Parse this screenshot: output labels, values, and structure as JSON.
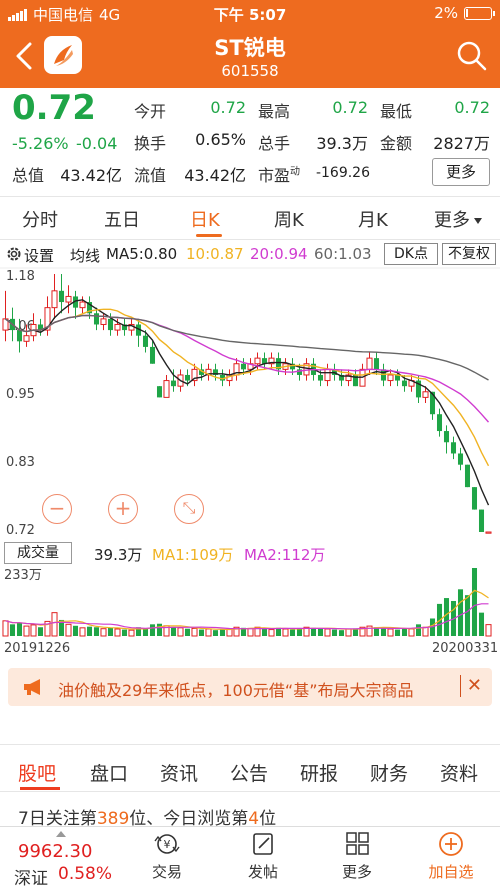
{
  "status": {
    "carrier": "中国电信",
    "network": "4G",
    "time": "下午 5:07",
    "battery": "2%"
  },
  "header": {
    "title": "ST锐电",
    "code": "601558"
  },
  "quote": {
    "price": "0.72",
    "change_pct": "-5.26%",
    "change": "-0.04",
    "fields": [
      {
        "label": "今开",
        "value": "0.72",
        "color": "#1fa547"
      },
      {
        "label": "最高",
        "value": "0.72",
        "color": "#1fa547"
      },
      {
        "label": "最低",
        "value": "0.72",
        "color": "#1fa547"
      },
      {
        "label": "换手",
        "value": "0.65%",
        "color": "#222222"
      },
      {
        "label": "总手",
        "value": "39.3万",
        "color": "#222222"
      },
      {
        "label": "金额",
        "value": "2827万",
        "color": "#222222"
      },
      {
        "label": "总值",
        "value": "43.42亿",
        "color": "#222222"
      },
      {
        "label": "流值",
        "value": "43.42亿",
        "color": "#222222"
      }
    ],
    "pe_label": "市盈",
    "pe_sup": "动",
    "pe_value": "-169.26",
    "more_label": "更多"
  },
  "tabs": [
    "分时",
    "五日",
    "日K",
    "周K",
    "月K",
    "更多"
  ],
  "active_tab": "日K",
  "ma_row": {
    "settings": "设置",
    "ma_label": "均线",
    "ma5": "MA5:0.80",
    "ma10": "10:0.87",
    "ma20": "20:0.94",
    "ma60": "60:1.03",
    "dk": "DK点",
    "fq": "不复权"
  },
  "colors": {
    "accent": "#ee6b1f",
    "up": "#e02020",
    "down": "#1fa547",
    "ma5": "#222222",
    "ma10": "#f0b323",
    "ma20": "#d03cd0",
    "ma60": "#666666"
  },
  "price_axis": [
    "1.18",
    "1.06",
    "0.95",
    "0.83",
    "0.72"
  ],
  "volume": {
    "label": "成交量",
    "value": "39.3万",
    "ma1": "MA1:109万",
    "ma2": "MA2:112万",
    "axis_max": "233万"
  },
  "dates": {
    "start": "20191226",
    "end": "20200331"
  },
  "chart_data": {
    "type": "candlestick",
    "ylim": [
      0.72,
      1.18
    ],
    "x_range": [
      "20191226",
      "20200331"
    ],
    "candles": [
      {
        "o": 1.08,
        "c": 1.1,
        "h": 1.15,
        "l": 1.06,
        "v": 52
      },
      {
        "o": 1.1,
        "c": 1.08,
        "h": 1.12,
        "l": 1.06,
        "v": 40
      },
      {
        "o": 1.08,
        "c": 1.06,
        "h": 1.1,
        "l": 1.04,
        "v": 45
      },
      {
        "o": 1.06,
        "c": 1.07,
        "h": 1.09,
        "l": 1.05,
        "v": 34
      },
      {
        "o": 1.07,
        "c": 1.09,
        "h": 1.11,
        "l": 1.06,
        "v": 38
      },
      {
        "o": 1.09,
        "c": 1.08,
        "h": 1.1,
        "l": 1.07,
        "v": 30
      },
      {
        "o": 1.08,
        "c": 1.12,
        "h": 1.14,
        "l": 1.07,
        "v": 50
      },
      {
        "o": 1.12,
        "c": 1.15,
        "h": 1.18,
        "l": 1.1,
        "v": 80
      },
      {
        "o": 1.15,
        "c": 1.13,
        "h": 1.18,
        "l": 1.11,
        "v": 55
      },
      {
        "o": 1.13,
        "c": 1.14,
        "h": 1.16,
        "l": 1.11,
        "v": 40
      },
      {
        "o": 1.14,
        "c": 1.12,
        "h": 1.15,
        "l": 1.1,
        "v": 35
      },
      {
        "o": 1.12,
        "c": 1.13,
        "h": 1.14,
        "l": 1.11,
        "v": 28
      },
      {
        "o": 1.13,
        "c": 1.11,
        "h": 1.14,
        "l": 1.1,
        "v": 32
      },
      {
        "o": 1.11,
        "c": 1.09,
        "h": 1.12,
        "l": 1.08,
        "v": 30
      },
      {
        "o": 1.09,
        "c": 1.1,
        "h": 1.11,
        "l": 1.08,
        "v": 25
      },
      {
        "o": 1.1,
        "c": 1.08,
        "h": 1.11,
        "l": 1.07,
        "v": 28
      },
      {
        "o": 1.08,
        "c": 1.09,
        "h": 1.1,
        "l": 1.07,
        "v": 24
      },
      {
        "o": 1.09,
        "c": 1.08,
        "h": 1.1,
        "l": 1.07,
        "v": 22
      },
      {
        "o": 1.08,
        "c": 1.09,
        "h": 1.1,
        "l": 1.07,
        "v": 20
      },
      {
        "o": 1.09,
        "c": 1.07,
        "h": 1.1,
        "l": 1.05,
        "v": 30
      },
      {
        "o": 1.07,
        "c": 1.05,
        "h": 1.08,
        "l": 1.04,
        "v": 26
      },
      {
        "o": 1.05,
        "c": 1.02,
        "h": 1.06,
        "l": 1.02,
        "v": 40
      },
      {
        "o": 0.98,
        "c": 0.96,
        "h": 0.98,
        "l": 0.96,
        "v": 42
      },
      {
        "o": 0.96,
        "c": 0.99,
        "h": 1.0,
        "l": 0.96,
        "v": 35
      },
      {
        "o": 0.99,
        "c": 0.98,
        "h": 1.01,
        "l": 0.97,
        "v": 30
      },
      {
        "o": 0.98,
        "c": 1.0,
        "h": 1.01,
        "l": 0.97,
        "v": 28
      },
      {
        "o": 1.0,
        "c": 0.99,
        "h": 1.01,
        "l": 0.98,
        "v": 25
      },
      {
        "o": 0.99,
        "c": 1.01,
        "h": 1.02,
        "l": 0.98,
        "v": 26
      },
      {
        "o": 1.01,
        "c": 1.0,
        "h": 1.02,
        "l": 0.99,
        "v": 22
      },
      {
        "o": 1.0,
        "c": 1.01,
        "h": 1.02,
        "l": 0.99,
        "v": 24
      },
      {
        "o": 1.01,
        "c": 1.0,
        "h": 1.02,
        "l": 0.99,
        "v": 20
      },
      {
        "o": 1.0,
        "c": 0.99,
        "h": 1.01,
        "l": 0.98,
        "v": 22
      },
      {
        "o": 0.99,
        "c": 1.0,
        "h": 1.01,
        "l": 0.98,
        "v": 24
      },
      {
        "o": 1.0,
        "c": 1.02,
        "h": 1.03,
        "l": 0.99,
        "v": 30
      },
      {
        "o": 1.02,
        "c": 1.01,
        "h": 1.03,
        "l": 1.0,
        "v": 28
      },
      {
        "o": 1.01,
        "c": 1.02,
        "h": 1.03,
        "l": 1.0,
        "v": 26
      },
      {
        "o": 1.02,
        "c": 1.03,
        "h": 1.04,
        "l": 1.01,
        "v": 30
      },
      {
        "o": 1.03,
        "c": 1.02,
        "h": 1.04,
        "l": 1.01,
        "v": 26
      },
      {
        "o": 1.02,
        "c": 1.03,
        "h": 1.04,
        "l": 1.01,
        "v": 22
      },
      {
        "o": 1.03,
        "c": 1.01,
        "h": 1.04,
        "l": 1.0,
        "v": 28
      },
      {
        "o": 1.01,
        "c": 1.02,
        "h": 1.03,
        "l": 1.0,
        "v": 24
      },
      {
        "o": 1.02,
        "c": 1.01,
        "h": 1.03,
        "l": 1.0,
        "v": 22
      },
      {
        "o": 1.01,
        "c": 1.0,
        "h": 1.02,
        "l": 0.99,
        "v": 26
      },
      {
        "o": 1.0,
        "c": 1.02,
        "h": 1.03,
        "l": 0.99,
        "v": 30
      },
      {
        "o": 1.02,
        "c": 1.0,
        "h": 1.03,
        "l": 0.99,
        "v": 28
      },
      {
        "o": 1.0,
        "c": 0.99,
        "h": 1.01,
        "l": 0.98,
        "v": 26
      },
      {
        "o": 0.99,
        "c": 1.01,
        "h": 1.02,
        "l": 0.98,
        "v": 24
      },
      {
        "o": 1.01,
        "c": 1.0,
        "h": 1.02,
        "l": 0.99,
        "v": 22
      },
      {
        "o": 1.0,
        "c": 0.99,
        "h": 1.01,
        "l": 0.98,
        "v": 20
      },
      {
        "o": 0.99,
        "c": 1.0,
        "h": 1.01,
        "l": 0.98,
        "v": 24
      },
      {
        "o": 1.0,
        "c": 0.98,
        "h": 1.01,
        "l": 0.98,
        "v": 26
      },
      {
        "o": 0.98,
        "c": 1.01,
        "h": 1.02,
        "l": 0.98,
        "v": 30
      },
      {
        "o": 1.01,
        "c": 1.03,
        "h": 1.04,
        "l": 1.0,
        "v": 34
      },
      {
        "o": 1.03,
        "c": 1.01,
        "h": 1.04,
        "l": 1.0,
        "v": 30
      },
      {
        "o": 1.01,
        "c": 0.99,
        "h": 1.02,
        "l": 0.98,
        "v": 28
      },
      {
        "o": 0.99,
        "c": 1.0,
        "h": 1.01,
        "l": 0.98,
        "v": 24
      },
      {
        "o": 1.0,
        "c": 0.99,
        "h": 1.01,
        "l": 0.98,
        "v": 22
      },
      {
        "o": 0.99,
        "c": 0.98,
        "h": 1.0,
        "l": 0.97,
        "v": 26
      },
      {
        "o": 0.98,
        "c": 0.99,
        "h": 1.0,
        "l": 0.97,
        "v": 24
      },
      {
        "o": 0.99,
        "c": 0.96,
        "h": 1.0,
        "l": 0.95,
        "v": 40
      },
      {
        "o": 0.96,
        "c": 0.97,
        "h": 0.98,
        "l": 0.95,
        "v": 30
      },
      {
        "o": 0.97,
        "c": 0.93,
        "h": 0.97,
        "l": 0.92,
        "v": 60
      },
      {
        "o": 0.93,
        "c": 0.9,
        "h": 0.94,
        "l": 0.89,
        "v": 110
      },
      {
        "o": 0.9,
        "c": 0.88,
        "h": 0.91,
        "l": 0.86,
        "v": 130
      },
      {
        "o": 0.88,
        "c": 0.86,
        "h": 0.89,
        "l": 0.85,
        "v": 120
      },
      {
        "o": 0.86,
        "c": 0.84,
        "h": 0.87,
        "l": 0.83,
        "v": 160
      },
      {
        "o": 0.84,
        "c": 0.8,
        "h": 0.84,
        "l": 0.8,
        "v": 140
      },
      {
        "o": 0.8,
        "c": 0.76,
        "h": 0.8,
        "l": 0.76,
        "v": 233
      },
      {
        "o": 0.76,
        "c": 0.72,
        "h": 0.76,
        "l": 0.72,
        "v": 80
      },
      {
        "o": 0.72,
        "c": 0.72,
        "h": 0.72,
        "l": 0.72,
        "v": 39
      }
    ]
  },
  "banner": {
    "text": "油价触及29年来低点，100元借“基”布局大宗商品"
  },
  "subtabs": [
    "股吧",
    "盘口",
    "资讯",
    "公告",
    "研报",
    "财务",
    "资料"
  ],
  "active_subtab": "股吧",
  "ranking": {
    "prefix": "7日关注第",
    "follow_rank": "389",
    "mid": "位、今日浏览第",
    "view_rank": "4",
    "suffix": "位"
  },
  "bottom_nav": {
    "index_value": "9962.30",
    "index_name": "深证",
    "index_change": "0.58%",
    "items": [
      "交易",
      "发帖",
      "更多",
      "加自选"
    ]
  }
}
